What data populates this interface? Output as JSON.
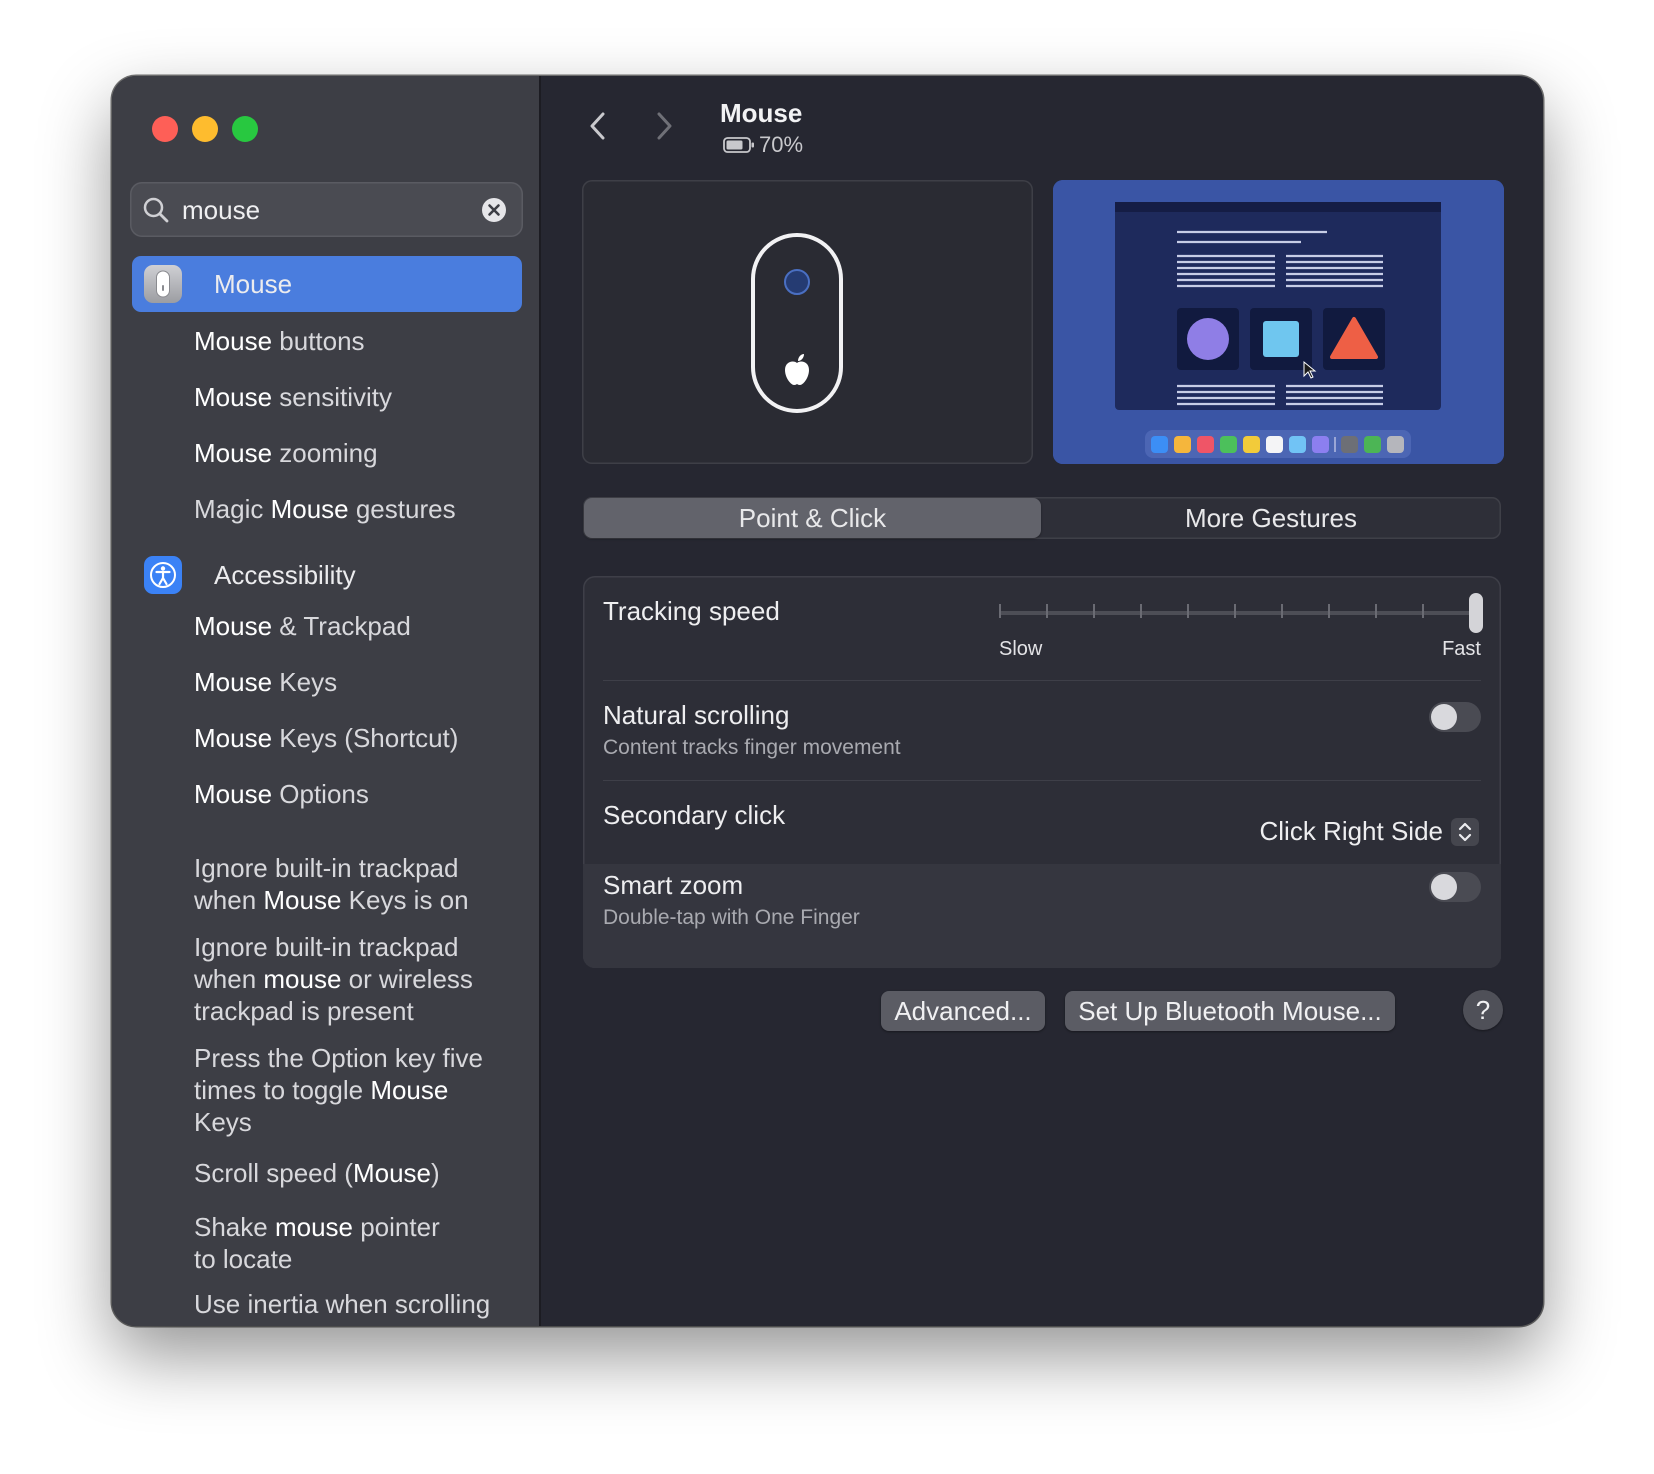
{
  "window": {
    "title": "Mouse",
    "battery": "70%"
  },
  "search": {
    "value": "mouse"
  },
  "sidebar": {
    "selected": {
      "label": "Mouse"
    },
    "mouse_results": [
      {
        "prefix": "",
        "hl": "Mouse",
        "suffix": " buttons"
      },
      {
        "prefix": "",
        "hl": "Mouse",
        "suffix": " sensitivity"
      },
      {
        "prefix": "",
        "hl": "Mouse",
        "suffix": " zooming"
      },
      {
        "prefix": "Magic ",
        "hl": "Mouse",
        "suffix": " gestures"
      }
    ],
    "accessibility": {
      "label": "Accessibility"
    },
    "accessibility_results": [
      {
        "prefix": "",
        "hl": "Mouse",
        "suffix": " & Trackpad"
      },
      {
        "prefix": "",
        "hl": "Mouse",
        "suffix": " Keys"
      },
      {
        "prefix": "",
        "hl": "Mouse",
        "suffix": " Keys (Shortcut)"
      },
      {
        "prefix": "",
        "hl": "Mouse",
        "suffix": " Options"
      },
      {
        "prefix": "Ignore built-in trackpad when ",
        "hl": "Mouse",
        "suffix": " Keys is on"
      },
      {
        "prefix": "Ignore built-in trackpad when ",
        "hl": "mouse",
        "suffix": " or wireless trackpad is present"
      },
      {
        "prefix": "Press the Option key five times to toggle ",
        "hl": "Mouse",
        "suffix": " Keys"
      },
      {
        "prefix": "Scroll speed (",
        "hl": "Mouse",
        "suffix": ")"
      },
      {
        "prefix": "Shake ",
        "hl": "mouse",
        "suffix": " pointer to locate"
      },
      {
        "prefix": "Use inertia when scrolling",
        "hl": "",
        "suffix": ""
      }
    ]
  },
  "tabs": {
    "point_click": "Point & Click",
    "more_gestures": "More Gestures"
  },
  "settings": {
    "tracking_speed": {
      "label": "Tracking speed",
      "min_label": "Slow",
      "max_label": "Fast",
      "value": 10,
      "max": 10
    },
    "natural_scrolling": {
      "label": "Natural scrolling",
      "sub": "Content tracks finger movement",
      "enabled": false
    },
    "secondary_click": {
      "label": "Secondary click",
      "value": "Click Right Side"
    },
    "smart_zoom": {
      "label": "Smart zoom",
      "sub": "Double-tap with One Finger",
      "enabled": false
    }
  },
  "buttons": {
    "advanced": "Advanced...",
    "bluetooth": "Set Up Bluetooth Mouse...",
    "help": "?"
  },
  "icons": {
    "search": "magnifying-glass",
    "clear": "x-circle",
    "mouse_app": "mouse",
    "accessibility": "accessibility-figure",
    "back": "chevron-left",
    "forward": "chevron-right",
    "battery": "battery",
    "popup": "chevron-up-down"
  },
  "colors": {
    "accent": "#4a7dde",
    "accessibility_icon": "#3b82f6",
    "window_bg": "#262731",
    "sidebar_bg": "#3d3e45"
  }
}
